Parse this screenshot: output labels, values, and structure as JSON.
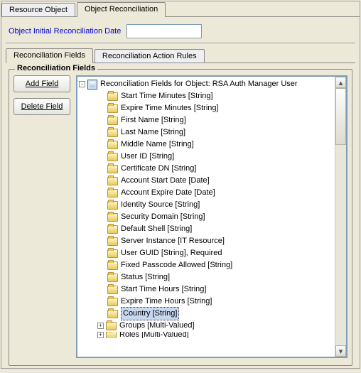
{
  "topTabs": {
    "resourceObject": "Resource Object",
    "objectReconciliation": "Object Reconciliation"
  },
  "form": {
    "initialReconDateLabel": "Object Initial Reconciliation Date",
    "initialReconDateValue": ""
  },
  "innerTabs": {
    "fields": "Reconciliation Fields",
    "actionRules": "Reconciliation Action Rules"
  },
  "fieldset": {
    "legend": "Reconciliation Fields"
  },
  "buttons": {
    "add": "Add Field",
    "delete": "Delete Field"
  },
  "tree": {
    "rootLabel": "Reconciliation Fields for Object: RSA Auth Manager User",
    "selectedIndex": 18,
    "items": [
      "Start Time Minutes [String]",
      "Expire Time Minutes [String]",
      "First Name [String]",
      "Last Name [String]",
      "Middle Name [String]",
      "User ID [String]",
      "Certificate DN [String]",
      "Account Start Date [Date]",
      "Account Expire Date [Date]",
      "Identity Source [String]",
      "Security Domain [String]",
      "Default Shell [String]",
      "Server Instance [IT Resource]",
      "User GUID [String], Required",
      "Fixed Passcode Allowed [String]",
      "Status [String]",
      "Start Time Hours [String]",
      "Expire Time Hours [String]",
      "Country [String]",
      "Groups [Multi-Valued]",
      "Roles [Multi-Valued]"
    ],
    "groupsExpandable": true,
    "rolesExpandable": true
  }
}
